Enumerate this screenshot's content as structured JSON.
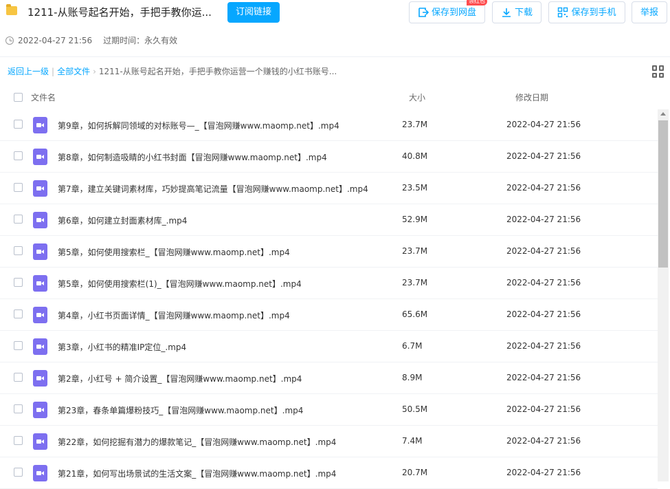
{
  "header": {
    "title": "1211-从账号起名开始，手把手教你运...",
    "subscribe_label": "订阅链接",
    "badge": "领红包",
    "save_to_disk": "保存到网盘",
    "download": "下载",
    "save_to_phone": "保存到手机",
    "report": "举报",
    "created": "2022-04-27 21:56",
    "expire": "过期时间：永久有效",
    "accent_color": "#06a7ff"
  },
  "breadcrumb": {
    "back": "返回上一级",
    "all_files": "全部文件",
    "current": "1211-从账号起名开始，手把手教你运营一个赚钱的小红书账号..."
  },
  "columns": {
    "name": "文件名",
    "size": "大小",
    "date": "修改日期"
  },
  "files": [
    {
      "name": "第9章，如何拆解同领域的对标账号—_【冒泡网赚www.maomp.net】.mp4",
      "size": "23.7M",
      "date": "2022-04-27 21:56"
    },
    {
      "name": "第8章，如何制造吸睛的小红书封面【冒泡网赚www.maomp.net】.mp4",
      "size": "40.8M",
      "date": "2022-04-27 21:56"
    },
    {
      "name": "第7章，建立关键词素材库，巧妙提高笔记流量【冒泡网赚www.maomp.net】.mp4",
      "size": "23.5M",
      "date": "2022-04-27 21:56"
    },
    {
      "name": "第6章，如何建立封面素材库_.mp4",
      "size": "52.9M",
      "date": "2022-04-27 21:56"
    },
    {
      "name": "第5章，如何使用搜索栏_【冒泡网赚www.maomp.net】.mp4",
      "size": "23.7M",
      "date": "2022-04-27 21:56"
    },
    {
      "name": "第5章，如何使用搜索栏(1)_【冒泡网赚www.maomp.net】.mp4",
      "size": "23.7M",
      "date": "2022-04-27 21:56"
    },
    {
      "name": "第4章，小红书页面详情_【冒泡网赚www.maomp.net】.mp4",
      "size": "65.6M",
      "date": "2022-04-27 21:56"
    },
    {
      "name": "第3章，小红书的精准IP定位_.mp4",
      "size": "6.7M",
      "date": "2022-04-27 21:56"
    },
    {
      "name": "第2章，小红号 + 简介设置_【冒泡网赚www.maomp.net】.mp4",
      "size": "8.9M",
      "date": "2022-04-27 21:56"
    },
    {
      "name": "第23章，春条单篇爆粉技巧_【冒泡网赚www.maomp.net】.mp4",
      "size": "50.5M",
      "date": "2022-04-27 21:56"
    },
    {
      "name": "第22章，如何挖掘有潜力的爆款笔记_【冒泡网赚www.maomp.net】.mp4",
      "size": "7.4M",
      "date": "2022-04-27 21:56"
    },
    {
      "name": "第21章，如何写出场景试的生活文案_【冒泡网赚www.maomp.net】.mp4",
      "size": "20.7M",
      "date": "2022-04-27 21:56"
    }
  ]
}
